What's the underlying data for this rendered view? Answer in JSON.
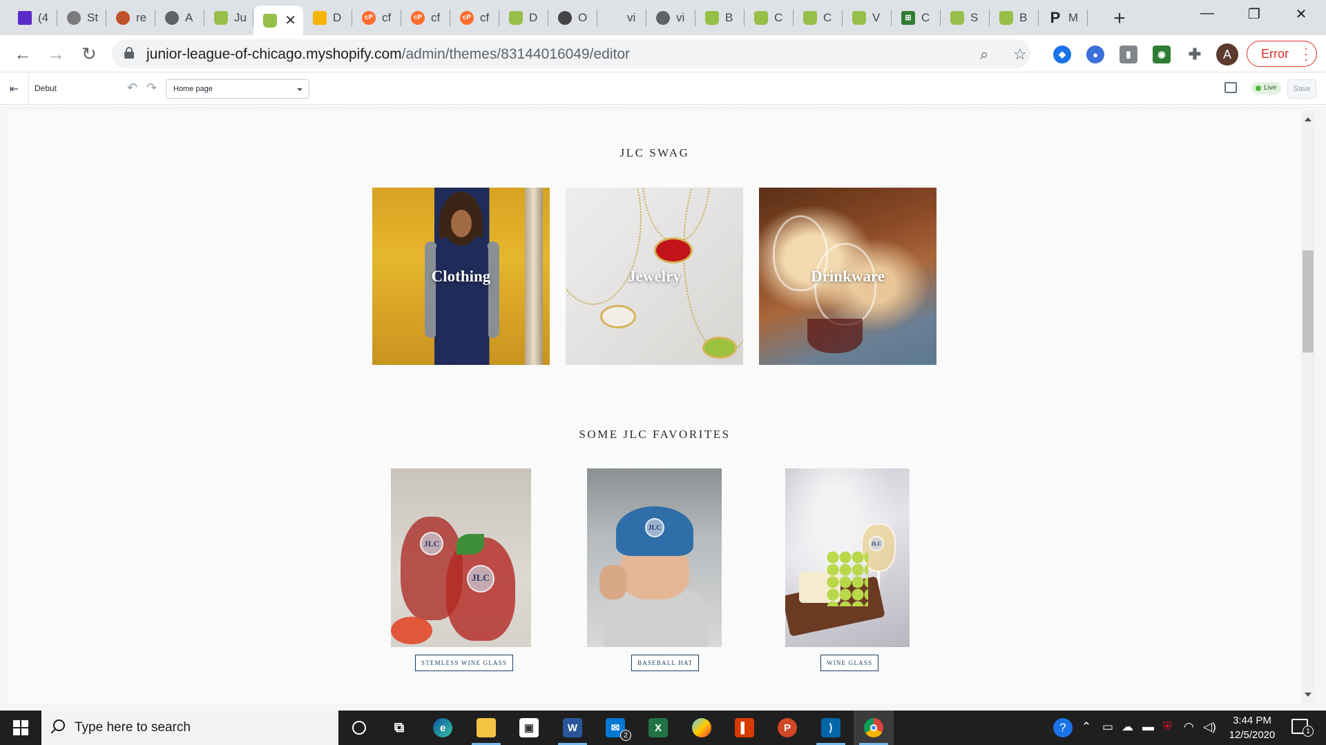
{
  "browser": {
    "tabs": [
      {
        "label": "(4",
        "icon": "mail-icon"
      },
      {
        "label": "St",
        "icon": "bird-icon"
      },
      {
        "label": "re",
        "icon": "swirl-icon"
      },
      {
        "label": "A",
        "icon": "globe-icon"
      },
      {
        "label": "Ju",
        "icon": "shopify-icon"
      },
      {
        "label": "",
        "icon": "shopify-icon",
        "active": true
      },
      {
        "label": "D",
        "icon": "drive-icon"
      },
      {
        "label": "cf",
        "icon": "cpanel-icon"
      },
      {
        "label": "cf",
        "icon": "cpanel-icon"
      },
      {
        "label": "cf",
        "icon": "cpanel-icon"
      },
      {
        "label": "D",
        "icon": "shopify-icon"
      },
      {
        "label": "O",
        "icon": "dark-icon"
      },
      {
        "label": "vi",
        "icon": "blank-icon"
      },
      {
        "label": "vi",
        "icon": "globe-icon"
      },
      {
        "label": "B",
        "icon": "shopify-icon"
      },
      {
        "label": "C",
        "icon": "shopify-icon"
      },
      {
        "label": "C",
        "icon": "shopify-icon"
      },
      {
        "label": "V",
        "icon": "shopify-icon"
      },
      {
        "label": "C",
        "icon": "excel-icon"
      },
      {
        "label": "S",
        "icon": "shopify-icon"
      },
      {
        "label": "B",
        "icon": "shopify-icon"
      },
      {
        "label": "M",
        "icon": "paypal-icon"
      }
    ],
    "url_host": "junior-league-of-chicago.myshopify.com",
    "url_path": "/admin/themes/83144016049/editor",
    "profile_initial": "A",
    "error_label": "Error"
  },
  "editor": {
    "theme_name": "Debut",
    "page_select": "Home page",
    "live_label": "Live",
    "save_label": "Save"
  },
  "preview": {
    "swag_title": "JLC SWAG",
    "collections": [
      {
        "label": "Clothing"
      },
      {
        "label": "Jewelry"
      },
      {
        "label": "Drinkware"
      }
    ],
    "favorites_title": "SOME JLC FAVORITES",
    "products": [
      {
        "button": "STEMLESS WINE GLASS",
        "badge": "JLC"
      },
      {
        "button": "BASEBALL HAT",
        "badge": "JLC"
      },
      {
        "button": "WINE GLASS",
        "badge": "JLC"
      }
    ]
  },
  "taskbar": {
    "search_placeholder": "Type here to search",
    "time": "3:44 PM",
    "date": "12/5/2020",
    "mail_badge": "2",
    "notification_count": "1",
    "apps": [
      "cortana-icon",
      "task-view-icon",
      "edge-icon",
      "file-explorer-icon",
      "store-icon",
      "word-icon",
      "mail-icon",
      "excel-icon",
      "paint-icon",
      "office-icon",
      "powerpoint-icon",
      "vscode-icon",
      "chrome-icon"
    ]
  },
  "colors": {
    "accent_navy": "#1d3a5a",
    "error_red": "#d93025",
    "live_green": "#50b83c",
    "shopify_green": "#95bf47"
  }
}
